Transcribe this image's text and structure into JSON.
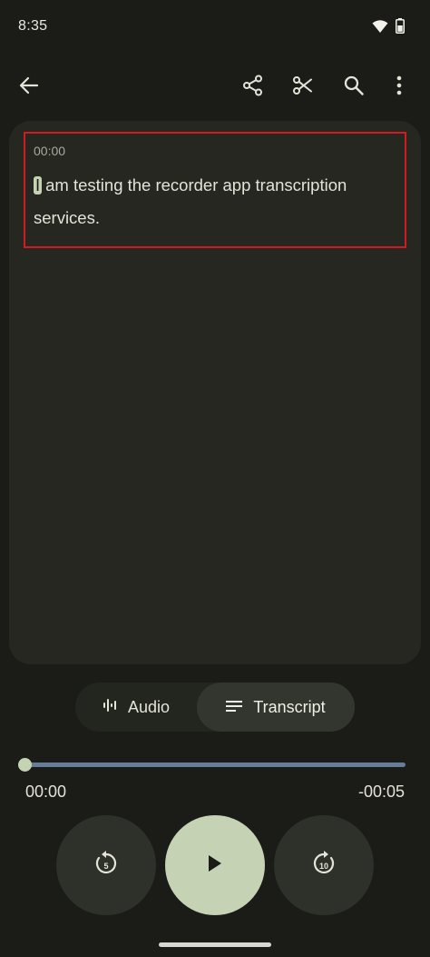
{
  "status_bar": {
    "time": "8:35",
    "icons": [
      "wifi-icon",
      "battery-icon"
    ]
  },
  "toolbar": {
    "icons": [
      "back-arrow-icon",
      "share-icon",
      "scissors-icon",
      "search-icon",
      "more-vert-icon"
    ]
  },
  "transcript": {
    "timestamp": "00:00",
    "first_word": "I",
    "rest_text": "am testing the recorder app transcription services."
  },
  "view_toggle": {
    "audio_label": "Audio",
    "transcript_label": "Transcript",
    "selected": "Transcript"
  },
  "playback": {
    "elapsed": "00:00",
    "remaining": "-00:05",
    "progress_fraction": 0.0,
    "rewind_seconds": "5",
    "forward_seconds": "10"
  },
  "colors": {
    "background": "#1b1c17",
    "panel": "#252720",
    "accent": "#c5d2b3",
    "highlight_border": "#d11a22",
    "progress_track": "#677c99"
  }
}
